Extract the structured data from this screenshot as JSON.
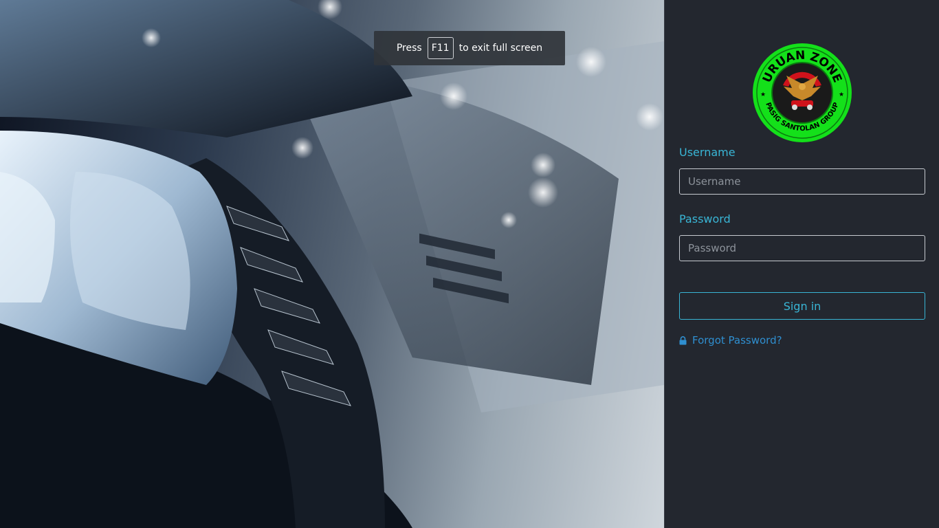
{
  "fullscreen_notice": {
    "press_text": "Press",
    "key_text": "F11",
    "suffix_text": "to exit full screen"
  },
  "logo": {
    "top_text": "URUAN ZONE",
    "bottom_text": "PASIG SANTOLAN GROUP",
    "ring_color": "#14e01a",
    "center_color": "#1a1a1a"
  },
  "login": {
    "username_label": "Username",
    "username_placeholder": "Username",
    "password_label": "Password",
    "password_placeholder": "Password",
    "signin_label": "Sign in",
    "forgot_label": "Forgot Password?",
    "forgot_icon": "lock-icon"
  },
  "colors": {
    "accent": "#39b6d6",
    "link": "#2f8fd0",
    "panel_bg": "#23272f"
  }
}
